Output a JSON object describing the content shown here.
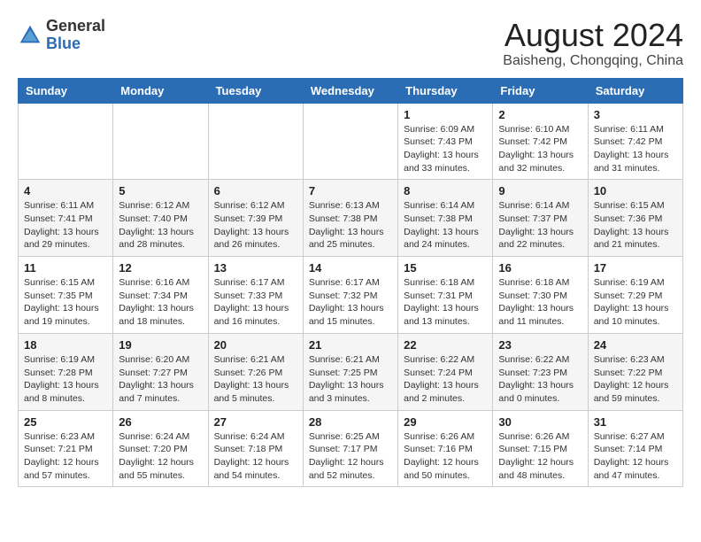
{
  "header": {
    "logo_general": "General",
    "logo_blue": "Blue",
    "month_year": "August 2024",
    "location": "Baisheng, Chongqing, China"
  },
  "days_of_week": [
    "Sunday",
    "Monday",
    "Tuesday",
    "Wednesday",
    "Thursday",
    "Friday",
    "Saturday"
  ],
  "weeks": [
    [
      {
        "day": "",
        "info": ""
      },
      {
        "day": "",
        "info": ""
      },
      {
        "day": "",
        "info": ""
      },
      {
        "day": "",
        "info": ""
      },
      {
        "day": "1",
        "info": "Sunrise: 6:09 AM\nSunset: 7:43 PM\nDaylight: 13 hours\nand 33 minutes."
      },
      {
        "day": "2",
        "info": "Sunrise: 6:10 AM\nSunset: 7:42 PM\nDaylight: 13 hours\nand 32 minutes."
      },
      {
        "day": "3",
        "info": "Sunrise: 6:11 AM\nSunset: 7:42 PM\nDaylight: 13 hours\nand 31 minutes."
      }
    ],
    [
      {
        "day": "4",
        "info": "Sunrise: 6:11 AM\nSunset: 7:41 PM\nDaylight: 13 hours\nand 29 minutes."
      },
      {
        "day": "5",
        "info": "Sunrise: 6:12 AM\nSunset: 7:40 PM\nDaylight: 13 hours\nand 28 minutes."
      },
      {
        "day": "6",
        "info": "Sunrise: 6:12 AM\nSunset: 7:39 PM\nDaylight: 13 hours\nand 26 minutes."
      },
      {
        "day": "7",
        "info": "Sunrise: 6:13 AM\nSunset: 7:38 PM\nDaylight: 13 hours\nand 25 minutes."
      },
      {
        "day": "8",
        "info": "Sunrise: 6:14 AM\nSunset: 7:38 PM\nDaylight: 13 hours\nand 24 minutes."
      },
      {
        "day": "9",
        "info": "Sunrise: 6:14 AM\nSunset: 7:37 PM\nDaylight: 13 hours\nand 22 minutes."
      },
      {
        "day": "10",
        "info": "Sunrise: 6:15 AM\nSunset: 7:36 PM\nDaylight: 13 hours\nand 21 minutes."
      }
    ],
    [
      {
        "day": "11",
        "info": "Sunrise: 6:15 AM\nSunset: 7:35 PM\nDaylight: 13 hours\nand 19 minutes."
      },
      {
        "day": "12",
        "info": "Sunrise: 6:16 AM\nSunset: 7:34 PM\nDaylight: 13 hours\nand 18 minutes."
      },
      {
        "day": "13",
        "info": "Sunrise: 6:17 AM\nSunset: 7:33 PM\nDaylight: 13 hours\nand 16 minutes."
      },
      {
        "day": "14",
        "info": "Sunrise: 6:17 AM\nSunset: 7:32 PM\nDaylight: 13 hours\nand 15 minutes."
      },
      {
        "day": "15",
        "info": "Sunrise: 6:18 AM\nSunset: 7:31 PM\nDaylight: 13 hours\nand 13 minutes."
      },
      {
        "day": "16",
        "info": "Sunrise: 6:18 AM\nSunset: 7:30 PM\nDaylight: 13 hours\nand 11 minutes."
      },
      {
        "day": "17",
        "info": "Sunrise: 6:19 AM\nSunset: 7:29 PM\nDaylight: 13 hours\nand 10 minutes."
      }
    ],
    [
      {
        "day": "18",
        "info": "Sunrise: 6:19 AM\nSunset: 7:28 PM\nDaylight: 13 hours\nand 8 minutes."
      },
      {
        "day": "19",
        "info": "Sunrise: 6:20 AM\nSunset: 7:27 PM\nDaylight: 13 hours\nand 7 minutes."
      },
      {
        "day": "20",
        "info": "Sunrise: 6:21 AM\nSunset: 7:26 PM\nDaylight: 13 hours\nand 5 minutes."
      },
      {
        "day": "21",
        "info": "Sunrise: 6:21 AM\nSunset: 7:25 PM\nDaylight: 13 hours\nand 3 minutes."
      },
      {
        "day": "22",
        "info": "Sunrise: 6:22 AM\nSunset: 7:24 PM\nDaylight: 13 hours\nand 2 minutes."
      },
      {
        "day": "23",
        "info": "Sunrise: 6:22 AM\nSunset: 7:23 PM\nDaylight: 13 hours\nand 0 minutes."
      },
      {
        "day": "24",
        "info": "Sunrise: 6:23 AM\nSunset: 7:22 PM\nDaylight: 12 hours\nand 59 minutes."
      }
    ],
    [
      {
        "day": "25",
        "info": "Sunrise: 6:23 AM\nSunset: 7:21 PM\nDaylight: 12 hours\nand 57 minutes."
      },
      {
        "day": "26",
        "info": "Sunrise: 6:24 AM\nSunset: 7:20 PM\nDaylight: 12 hours\nand 55 minutes."
      },
      {
        "day": "27",
        "info": "Sunrise: 6:24 AM\nSunset: 7:18 PM\nDaylight: 12 hours\nand 54 minutes."
      },
      {
        "day": "28",
        "info": "Sunrise: 6:25 AM\nSunset: 7:17 PM\nDaylight: 12 hours\nand 52 minutes."
      },
      {
        "day": "29",
        "info": "Sunrise: 6:26 AM\nSunset: 7:16 PM\nDaylight: 12 hours\nand 50 minutes."
      },
      {
        "day": "30",
        "info": "Sunrise: 6:26 AM\nSunset: 7:15 PM\nDaylight: 12 hours\nand 48 minutes."
      },
      {
        "day": "31",
        "info": "Sunrise: 6:27 AM\nSunset: 7:14 PM\nDaylight: 12 hours\nand 47 minutes."
      }
    ]
  ]
}
